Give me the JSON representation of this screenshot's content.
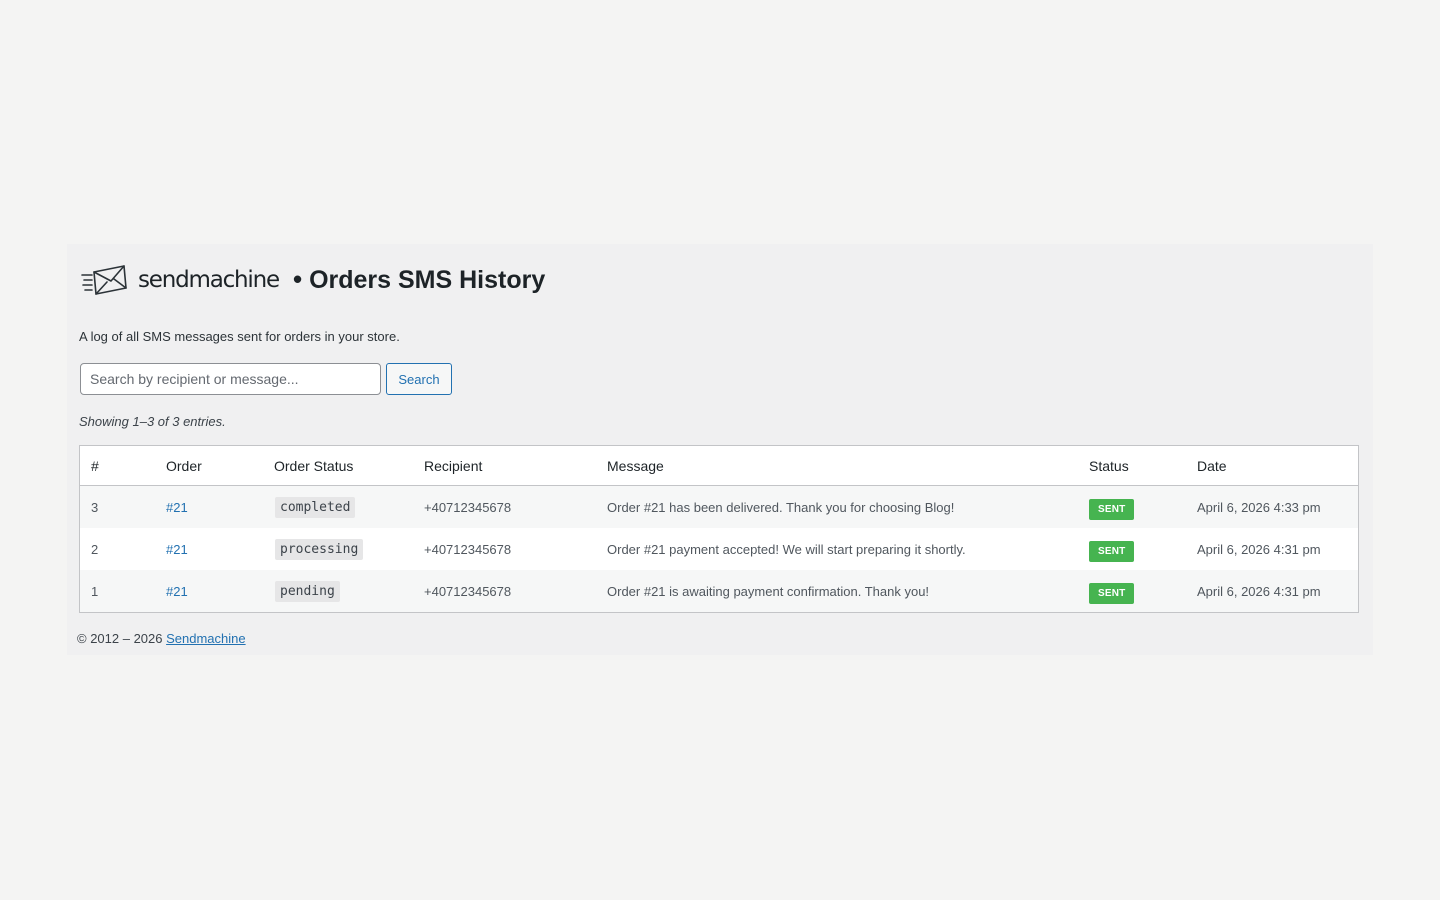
{
  "header": {
    "brand": "sendmachine",
    "bullet": "•",
    "title": "Orders SMS History"
  },
  "subtitle": "A log of all SMS messages sent for orders in your store.",
  "search": {
    "placeholder": "Search by recipient or message...",
    "value": "",
    "button_label": "Search"
  },
  "showing_text": "Showing 1–3 of 3 entries.",
  "table": {
    "columns": [
      "#",
      "Order",
      "Order Status",
      "Recipient",
      "Message",
      "Status",
      "Date"
    ],
    "rows": [
      {
        "id": "3",
        "order": "#21",
        "order_status": "completed",
        "recipient": "+40712345678",
        "message": "Order #21 has been delivered. Thank you for choosing Blog!",
        "status": "SENT",
        "date": "April 6, 2026 4:33 pm"
      },
      {
        "id": "2",
        "order": "#21",
        "order_status": "processing",
        "recipient": "+40712345678",
        "message": "Order #21 payment accepted! We will start preparing it shortly.",
        "status": "SENT",
        "date": "April 6, 2026 4:31 pm"
      },
      {
        "id": "1",
        "order": "#21",
        "order_status": "pending",
        "recipient": "+40712345678",
        "message": "Order #21 is awaiting payment confirmation. Thank you!",
        "status": "SENT",
        "date": "April 6, 2026 4:31 pm"
      }
    ]
  },
  "footer": {
    "copyright": "© 2012 – 2026",
    "link_text": "Sendmachine"
  },
  "colors": {
    "page_bg": "#f4f4f3",
    "panel_bg": "#f0f0f1",
    "link": "#2271b1",
    "sent_badge": "#46b450",
    "border": "#c3c4c7"
  },
  "icons": {
    "logo": "envelope-with-motion-lines-icon"
  }
}
